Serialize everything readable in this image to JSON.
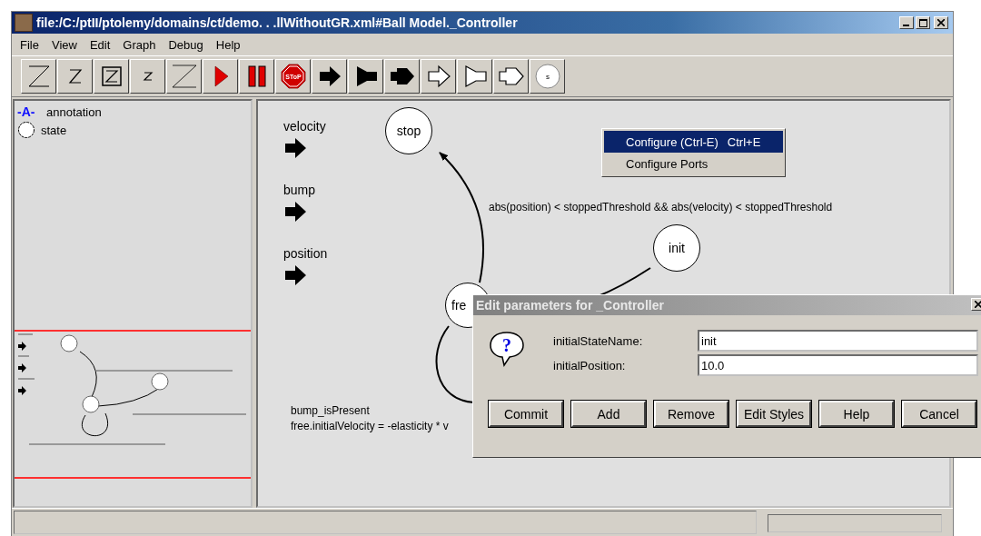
{
  "window": {
    "title": "file:/C:/ptII/ptolemy/domains/ct/demo. . .llWithoutGR.xml#Ball Model._Controller"
  },
  "menu_bar": [
    "File",
    "View",
    "Edit",
    "Graph",
    "Debug",
    "Help"
  ],
  "toolbar": [
    {
      "kind": "z-large"
    },
    {
      "kind": "z-medium"
    },
    {
      "kind": "z-boxed"
    },
    {
      "kind": "z-small"
    },
    {
      "kind": "z-wide"
    },
    {
      "kind": "run"
    },
    {
      "kind": "pause"
    },
    {
      "kind": "stop",
      "label": "SToP"
    },
    {
      "kind": "port-input"
    },
    {
      "kind": "port-output"
    },
    {
      "kind": "port-io"
    },
    {
      "kind": "port-input-hollow"
    },
    {
      "kind": "port-output-hollow"
    },
    {
      "kind": "port-io-hollow"
    },
    {
      "kind": "state",
      "label": "s"
    }
  ],
  "palette": [
    {
      "kind": "annotation",
      "glyph": "-A-",
      "label": "annotation"
    },
    {
      "kind": "state",
      "label": "state"
    }
  ],
  "canvas": {
    "ports": [
      "velocity",
      "bump",
      "position"
    ],
    "states": [
      "stop",
      "init",
      "fre"
    ],
    "guard": "abs(position) < stoppedThreshold && abs(velocity) < stoppedThreshold",
    "bump_annotation": [
      "bump_isPresent",
      "free.initialVelocity = -elasticity * v"
    ]
  },
  "context_menu": [
    {
      "label": "Configure (Ctrl-E)",
      "shortcut": "Ctrl+E",
      "selected": true
    },
    {
      "label": "Configure Ports",
      "selected": false
    }
  ],
  "dialog": {
    "title": "Edit parameters for _Controller",
    "icon_glyph": "?",
    "fields": [
      {
        "label": "initialStateName:",
        "value": "init"
      },
      {
        "label": "initialPosition:",
        "value": "10.0"
      }
    ],
    "buttons": [
      "Commit",
      "Add",
      "Remove",
      "Edit Styles",
      "Help",
      "Cancel"
    ]
  }
}
